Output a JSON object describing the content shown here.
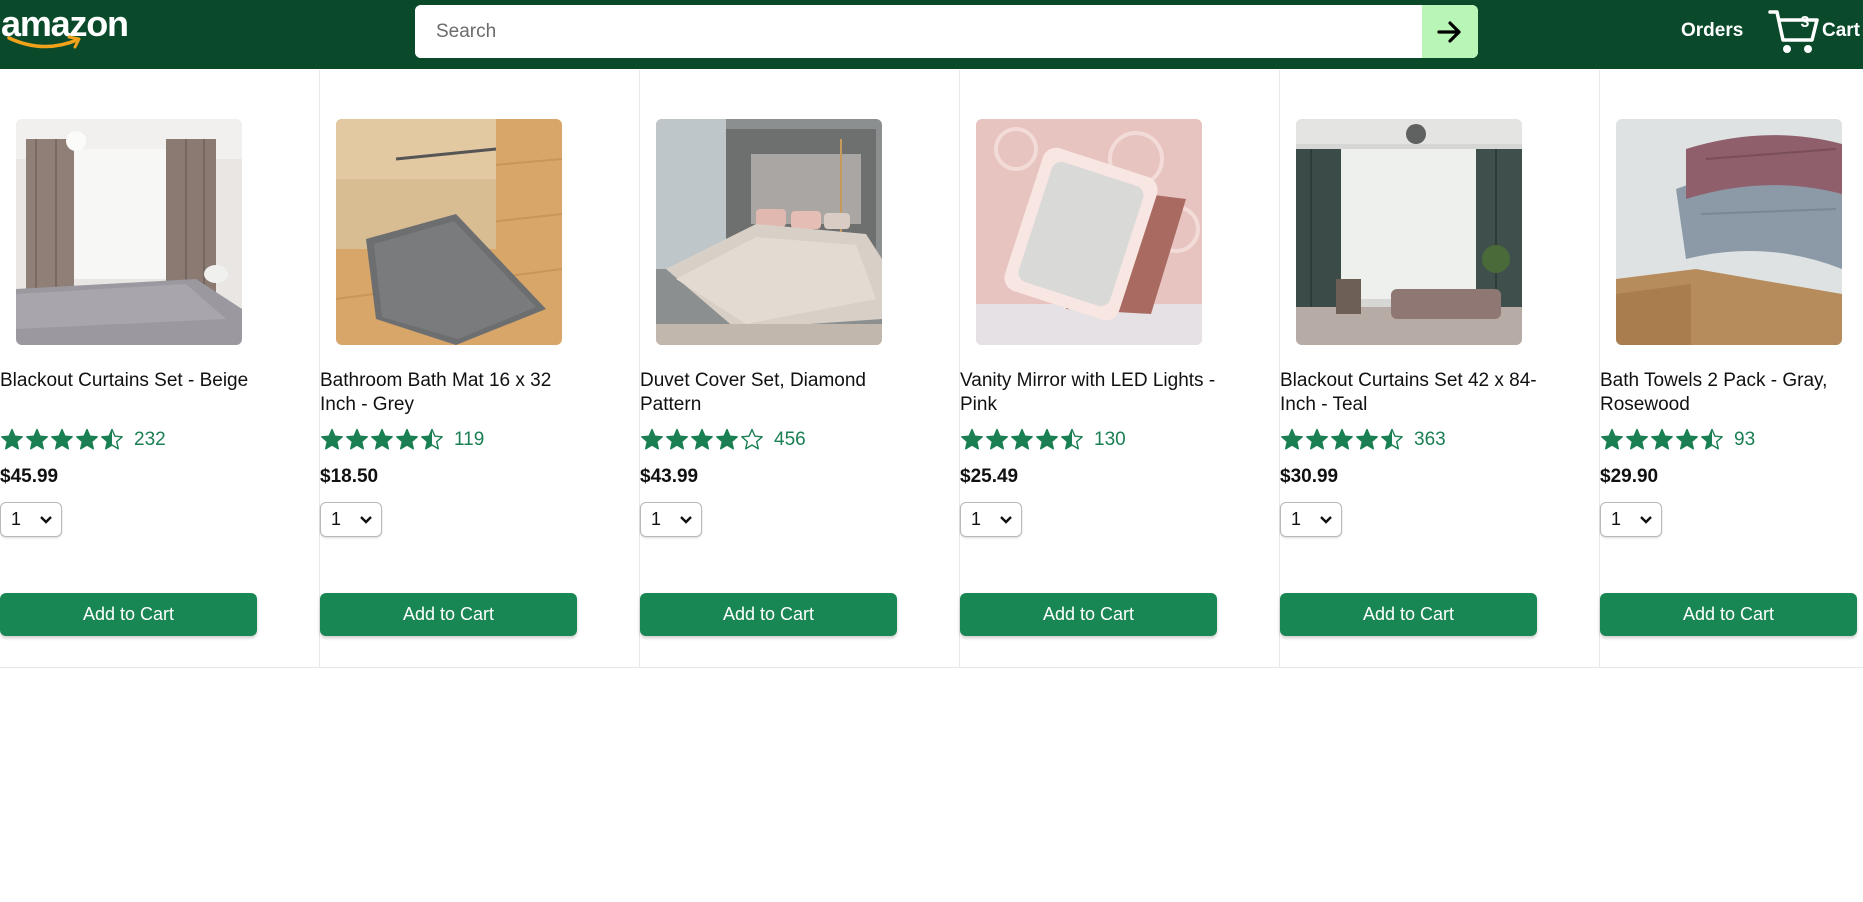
{
  "header": {
    "logo_text": "amazon",
    "search_placeholder": "Search",
    "search_value": "",
    "orders_label": "Orders",
    "cart_label": "Cart",
    "cart_count": "3"
  },
  "colors": {
    "header_bg": "#0a4a2b",
    "search_button_bg": "#b8f5b6",
    "button_bg": "#188753",
    "star_color": "#1a7f52",
    "logo_smile": "#f0a21b"
  },
  "products": [
    {
      "name": "Blackout Curtains Set - Beige",
      "rating": 4.5,
      "rating_count": "232",
      "price": "$45.99",
      "quantity": "1",
      "button_label": "Add to Cart",
      "image": "bedroom with beige curtains"
    },
    {
      "name": "Bathroom Bath Mat 16 x 32 Inch - Grey",
      "rating": 4.5,
      "rating_count": "119",
      "price": "$18.50",
      "quantity": "1",
      "button_label": "Add to Cart",
      "image": "grey bath mat on wood floor"
    },
    {
      "name": "Duvet Cover Set, Diamond Pattern",
      "rating": 4.0,
      "rating_count": "456",
      "price": "$43.99",
      "quantity": "1",
      "button_label": "Add to Cart",
      "image": "bedroom with beige duvet"
    },
    {
      "name": "Vanity Mirror with LED Lights - Pink",
      "rating": 4.5,
      "rating_count": "130",
      "price": "$25.49",
      "quantity": "1",
      "button_label": "Add to Cart",
      "image": "pink LED vanity mirror"
    },
    {
      "name": "Blackout Curtains Set 42 x 84-Inch - Teal",
      "rating": 4.5,
      "rating_count": "363",
      "price": "$30.99",
      "quantity": "1",
      "button_label": "Add to Cart",
      "image": "living room with teal curtains"
    },
    {
      "name": "Bath Towels 2 Pack - Gray, Rosewood",
      "rating": 4.5,
      "rating_count": "93",
      "price": "$29.90",
      "quantity": "1",
      "button_label": "Add to Cart",
      "image": "gray and rosewood towels"
    }
  ]
}
